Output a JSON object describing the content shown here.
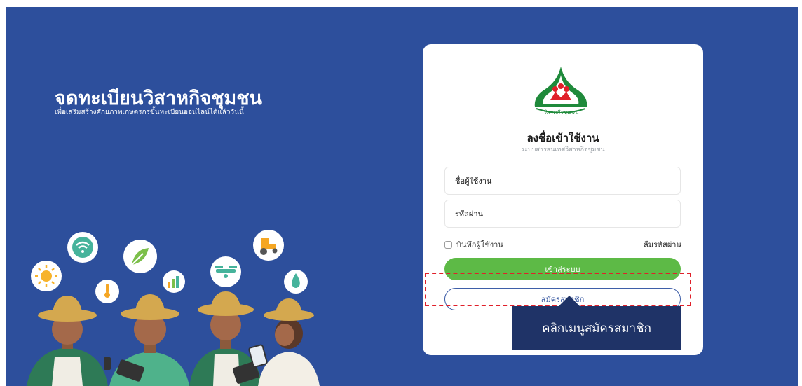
{
  "hero": {
    "title": "จดทะเบียนวิสาหกิจชุมชน",
    "subtitle": "เพื่อเสริมสร้างศักยภาพเกษตรกรขึ้นทะเบียนออนไลน์ได้แล้ววันนี้"
  },
  "login": {
    "logo_text": "วิสาหกิจชุมชน",
    "title": "ลงชื่อเข้าใช้งาน",
    "subtitle": "ระบบสารสนเทศวิสาหกิจชุมชน",
    "username_placeholder": "ชื่อผู้ใช้งาน",
    "password_placeholder": "รหัสผ่าน",
    "remember_label": "บันทึกผู้ใช้งาน",
    "forgot_label": "ลืมรหัสผ่าน",
    "login_button": "เข้าสู่ระบบ",
    "register_button": "สมัครสมาชิก"
  },
  "callout": {
    "text": "คลิกเมนูสมัครสมาชิก"
  },
  "colors": {
    "background": "#2d4f9c",
    "login_button": "#5dba46",
    "callout": "#1f3367",
    "highlight": "#e0202a"
  }
}
